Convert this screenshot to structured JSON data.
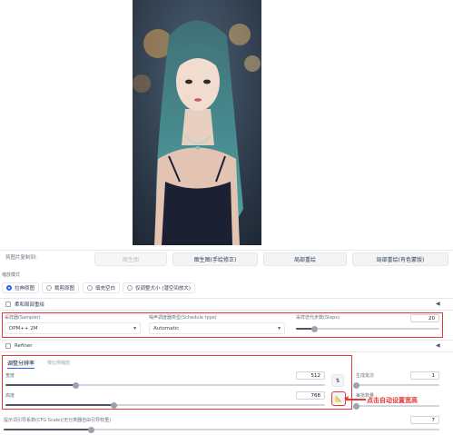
{
  "send_to": {
    "label": "将图片复制到:",
    "buttons": [
      "图生图",
      "图生图(手绘修正)",
      "局部重绘",
      "局部重绘(有色蒙版)"
    ]
  },
  "resize_mode": {
    "label": "缩放模式",
    "options": [
      "拉伸原图",
      "裁剪原图",
      "填充空白",
      "仅调整大小 (潜空间放大)"
    ],
    "selected": 0
  },
  "soft_inpaint": {
    "label": "柔和局部重绘"
  },
  "sampler": {
    "label": "采样器(Sampler)",
    "value": "DPM++ 2M",
    "schedule_label": "噪声调度器类型(Schedule type)",
    "schedule_value": "Automatic",
    "steps_label": "采样迭代步数(Steps)",
    "steps_value": "20",
    "steps_fraction": 0.13
  },
  "refiner": {
    "label": "Refiner"
  },
  "resolution": {
    "tab_active": "调整分辨率",
    "tab_other": "按比例缩放",
    "width_label": "宽度",
    "width_value": "512",
    "width_fraction": 0.22,
    "height_label": "高度",
    "height_value": "768",
    "height_fraction": 0.34,
    "batch_count_label": "生成批次",
    "batch_count_value": "1",
    "batch_size_label": "每批数量",
    "annotation": "点击自动设置宽高"
  },
  "cfg": {
    "label": "提示词引导系数(CFG Scale)(无分类器自由引导权重)",
    "value": "7",
    "fraction": 0.2
  },
  "colors": {
    "accent": "#2563eb",
    "annotation_red": "#e53935"
  }
}
